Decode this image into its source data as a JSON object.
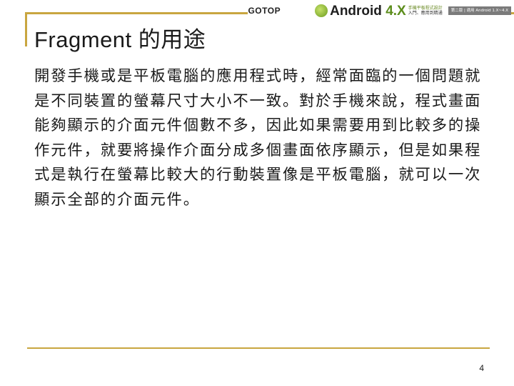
{
  "header": {
    "publisher": "GOTOP",
    "book_logo_main": "Android",
    "book_logo_version": "4.X",
    "badge_line1": "手機平板程式設計",
    "badge_line2": "入門、應用到精通",
    "series_tag": "第二版 | 適用 Android 1.X~4.X",
    "colors": {
      "rule": "#c9a640",
      "logo_green": "#5c8d1c"
    }
  },
  "slide": {
    "title": "Fragment 的用途",
    "body": "開發手機或是平板電腦的應用程式時，經常面臨的一個問題就是不同裝置的螢幕尺寸大小不一致。對於手機來說，程式畫面能夠顯示的介面元件個數不多，因此如果需要用到比較多的操作元件，就要將操作介面分成多個畫面依序顯示，但是如果程式是執行在螢幕比較大的行動裝置像是平板電腦，就可以一次顯示全部的介面元件。",
    "page_number": "4"
  }
}
